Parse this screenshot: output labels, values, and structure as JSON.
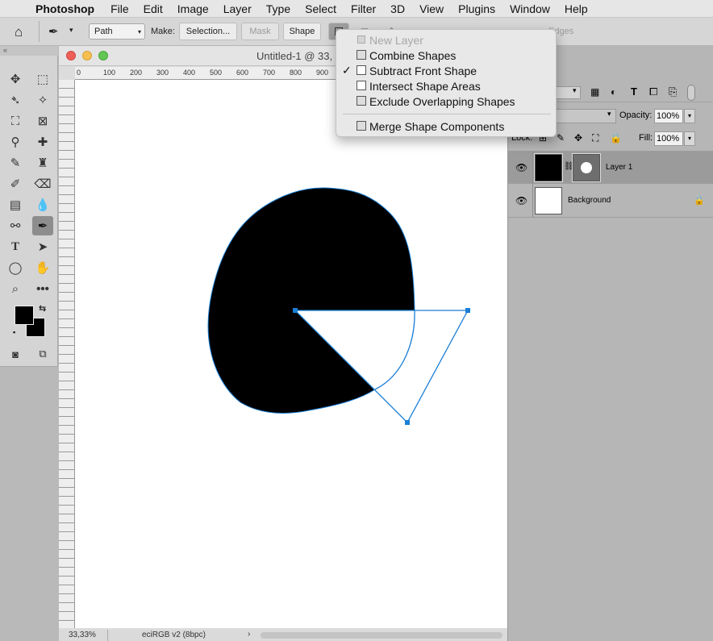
{
  "menubar": {
    "app": "Photoshop",
    "items": [
      "File",
      "Edit",
      "Image",
      "Layer",
      "Type",
      "Select",
      "Filter",
      "3D",
      "View",
      "Plugins",
      "Window",
      "Help"
    ]
  },
  "options": {
    "path_mode": "Path",
    "make_label": "Make:",
    "selection_btn": "Selection...",
    "mask_btn": "Mask",
    "shape_btn": "Shape",
    "faded_text": "Edges"
  },
  "document": {
    "title": "Untitled-1 @ 33,",
    "ruler_ticks": [
      "0",
      "100",
      "200",
      "300",
      "400",
      "500",
      "600",
      "700",
      "800",
      "900"
    ],
    "zoom": "33,33%",
    "profile": "eciRGB v2 (8bpc)"
  },
  "path_ops_menu": {
    "items": [
      {
        "label": "New Layer",
        "checked": false,
        "disabled": true
      },
      {
        "label": "Combine Shapes",
        "checked": false,
        "disabled": false
      },
      {
        "label": "Subtract Front Shape",
        "checked": true,
        "disabled": false
      },
      {
        "label": "Intersect Shape Areas",
        "checked": false,
        "disabled": false
      },
      {
        "label": "Exclude Overlapping Shapes",
        "checked": false,
        "disabled": false
      }
    ],
    "merge_label": "Merge Shape Components"
  },
  "layers_panel": {
    "opacity_label": "Opacity:",
    "opacity_value": "100%",
    "lock_label": "Lock:",
    "fill_label": "Fill:",
    "fill_value": "100%",
    "layers": [
      {
        "name": "Layer 1",
        "selected": true
      },
      {
        "name": "Background",
        "selected": false
      }
    ]
  },
  "colors": {
    "foreground": "#000000",
    "background": "#000000",
    "path_stroke": "#1a7fd6"
  }
}
